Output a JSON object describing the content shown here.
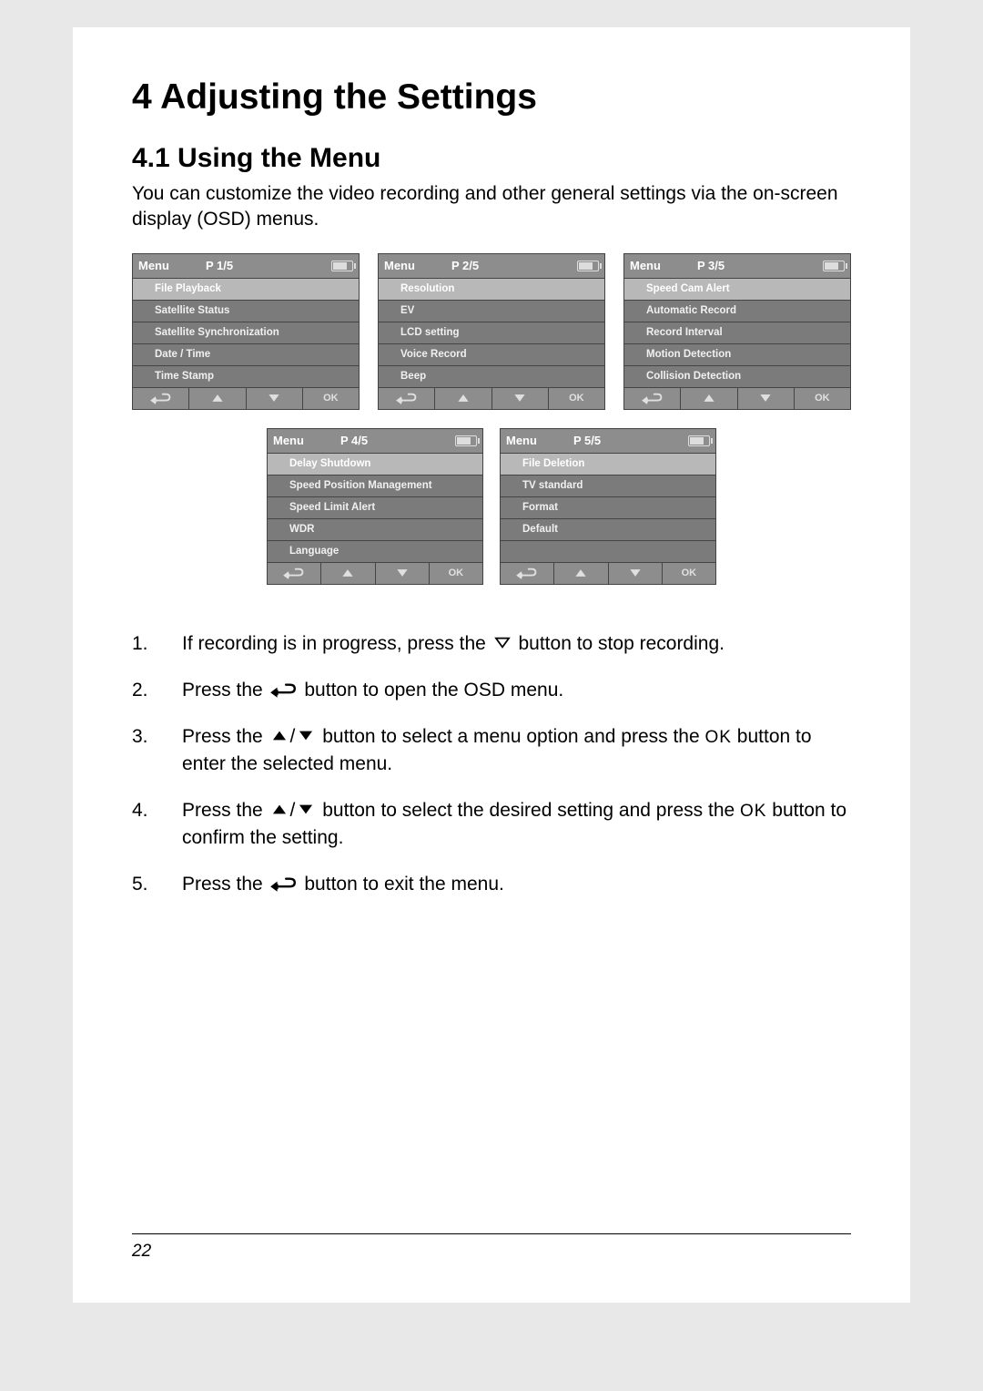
{
  "chapter": "4   Adjusting the Settings",
  "section": "4.1   Using the Menu",
  "intro": "You can customize the video recording and other general settings via the on-screen display (OSD) menus.",
  "menu_label": "Menu",
  "ok_label": "OK",
  "menus_top": [
    {
      "page": "P 1/5",
      "items": [
        "File Playback",
        "Satellite Status",
        "Satellite Synchronization",
        "Date / Time",
        "Time Stamp"
      ],
      "highlight": 0
    },
    {
      "page": "P 2/5",
      "items": [
        "Resolution",
        "EV",
        "LCD setting",
        "Voice Record",
        "Beep"
      ],
      "highlight": 0
    },
    {
      "page": "P 3/5",
      "items": [
        "Speed Cam Alert",
        "Automatic Record",
        "Record Interval",
        "Motion Detection",
        "Collision Detection"
      ],
      "highlight": 0
    }
  ],
  "menus_bottom": [
    {
      "page": "P 4/5",
      "items": [
        "Delay Shutdown",
        "Speed Position Management",
        "Speed Limit Alert",
        "WDR",
        "Language"
      ],
      "highlight": 0
    },
    {
      "page": "P 5/5",
      "items": [
        "File Deletion",
        "TV standard",
        "Format",
        "Default",
        ""
      ],
      "highlight": 0
    }
  ],
  "steps": [
    {
      "n": "1.",
      "parts": [
        "If recording is in progress, press the ",
        {
          "icon": "down"
        },
        " button to stop recording."
      ]
    },
    {
      "n": "2.",
      "parts": [
        "Press the ",
        {
          "icon": "return"
        },
        " button to open the OSD menu."
      ]
    },
    {
      "n": "3.",
      "parts": [
        "Press the ",
        {
          "icon": "up-solid"
        },
        "/",
        {
          "icon": "down-solid"
        },
        " button to select a menu option and press the ",
        {
          "icon": "ok"
        },
        " button to enter the selected menu."
      ]
    },
    {
      "n": "4.",
      "parts": [
        "Press the ",
        {
          "icon": "up-solid"
        },
        "/",
        {
          "icon": "down-solid"
        },
        " button to select the desired setting and press the ",
        {
          "icon": "ok"
        },
        " button to confirm the setting."
      ]
    },
    {
      "n": "5.",
      "parts": [
        "Press the ",
        {
          "icon": "return"
        },
        " button to exit the menu."
      ]
    }
  ],
  "page_number": "22"
}
